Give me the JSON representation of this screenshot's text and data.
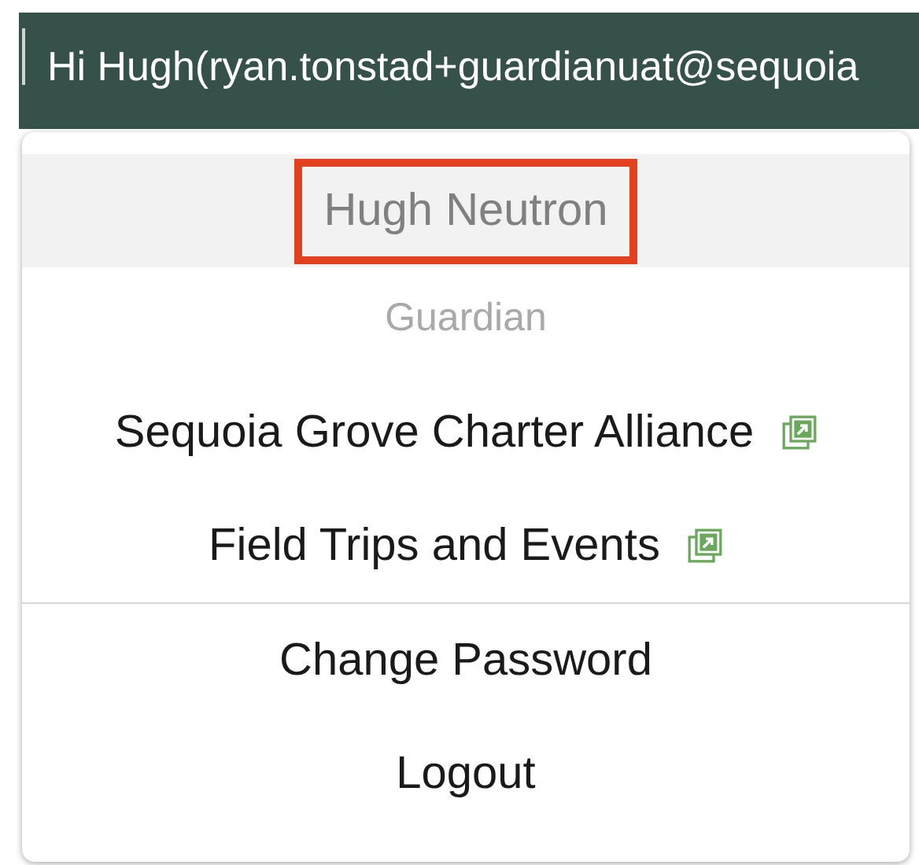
{
  "header": {
    "greeting": "Hi Hugh(ryan.tonstad+guardianuat@sequoia"
  },
  "menu": {
    "user_name": "Hugh Neutron",
    "highlighted": true,
    "role": "Guardian",
    "items": [
      {
        "label": "Sequoia Grove Charter Alliance",
        "external": true,
        "divider_below": false
      },
      {
        "label": "Field Trips and Events",
        "external": true,
        "divider_below": true
      },
      {
        "label": "Change Password",
        "external": false,
        "divider_below": false
      },
      {
        "label": "Logout",
        "external": false,
        "divider_below": false
      }
    ]
  }
}
